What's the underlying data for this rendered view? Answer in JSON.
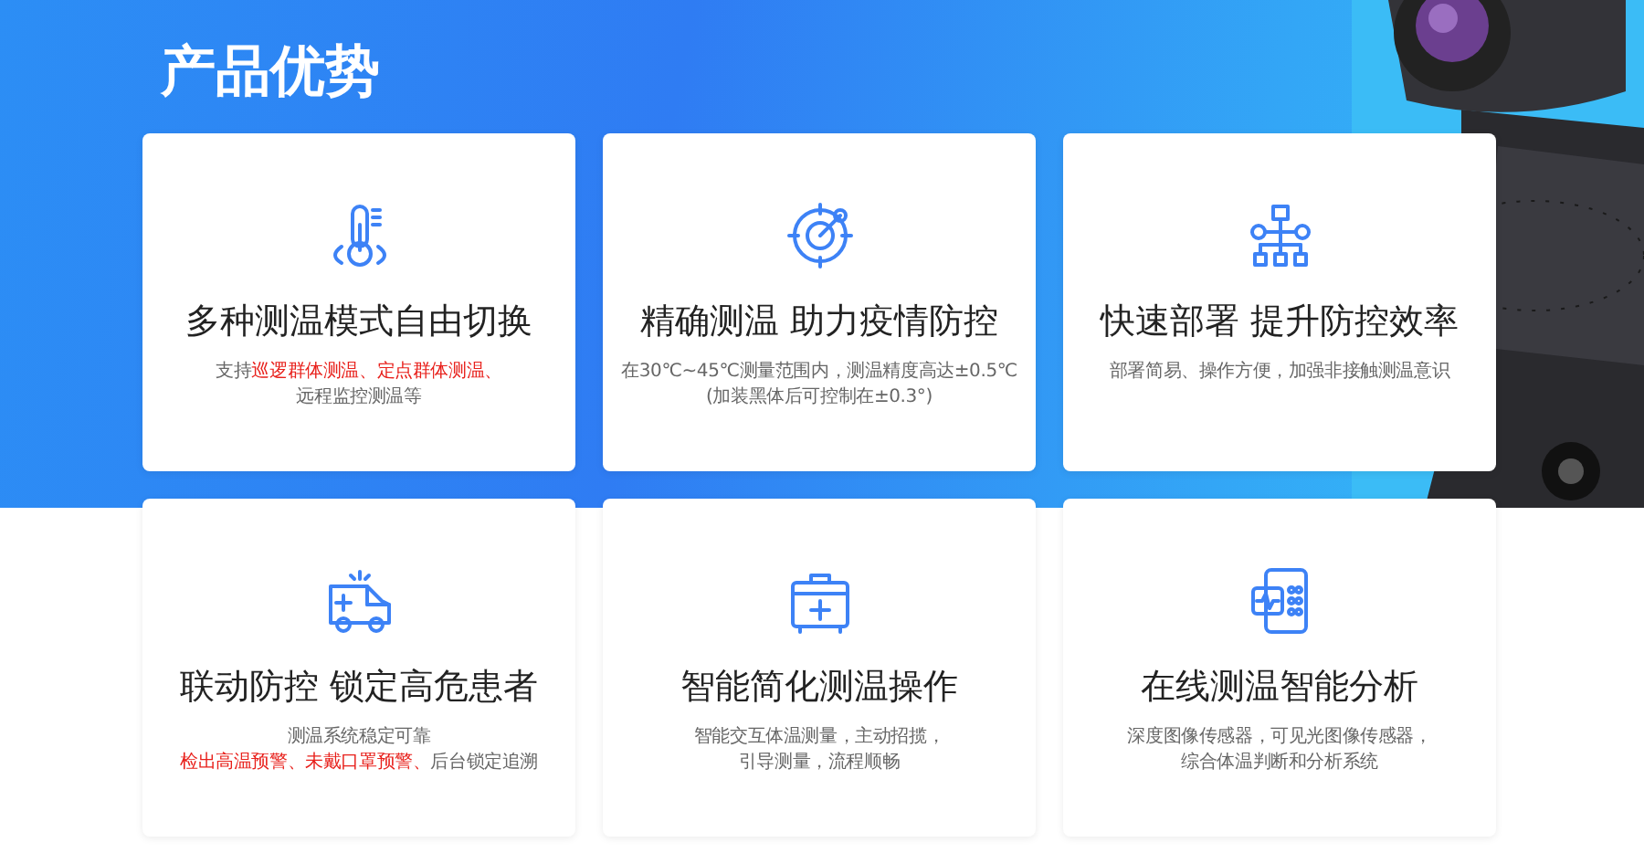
{
  "section_title": "产品优势",
  "cards": [
    {
      "title": "多种测温模式自由切换",
      "lines": [
        [
          {
            "text": "支持",
            "highlight": false
          },
          {
            "text": "巡逻群体测温、定点群体测温、",
            "highlight": true
          }
        ],
        [
          {
            "text": "远程监控测温等",
            "highlight": false
          }
        ]
      ]
    },
    {
      "title": "精确测温 助力疫情防控",
      "lines": [
        [
          {
            "text": "在30℃~45℃测量范围内，测温精度高达±0.5℃",
            "highlight": false
          }
        ],
        [
          {
            "text": "(加装黑体后可控制在±0.3°)",
            "highlight": false
          }
        ]
      ]
    },
    {
      "title": "快速部署 提升防控效率",
      "lines": [
        [
          {
            "text": "部署简易、操作方便，加强非接触测温意识",
            "highlight": false
          }
        ]
      ]
    },
    {
      "title": "联动防控 锁定高危患者",
      "lines": [
        [
          {
            "text": "测温系统稳定可靠",
            "highlight": false
          }
        ],
        [
          {
            "text": "检出高温预警、未戴口罩预警、",
            "highlight": true
          },
          {
            "text": "后台锁定追溯",
            "highlight": false
          }
        ]
      ]
    },
    {
      "title": "智能简化测温操作",
      "lines": [
        [
          {
            "text": "智能交互体温测量，主动招揽，",
            "highlight": false
          }
        ],
        [
          {
            "text": "引导测量，流程顺畅",
            "highlight": false
          }
        ]
      ]
    },
    {
      "title": "在线测温智能分析",
      "lines": [
        [
          {
            "text": "深度图像传感器，可见光图像传感器，",
            "highlight": false
          }
        ],
        [
          {
            "text": "综合体温判断和分析系统",
            "highlight": false
          }
        ]
      ]
    }
  ]
}
